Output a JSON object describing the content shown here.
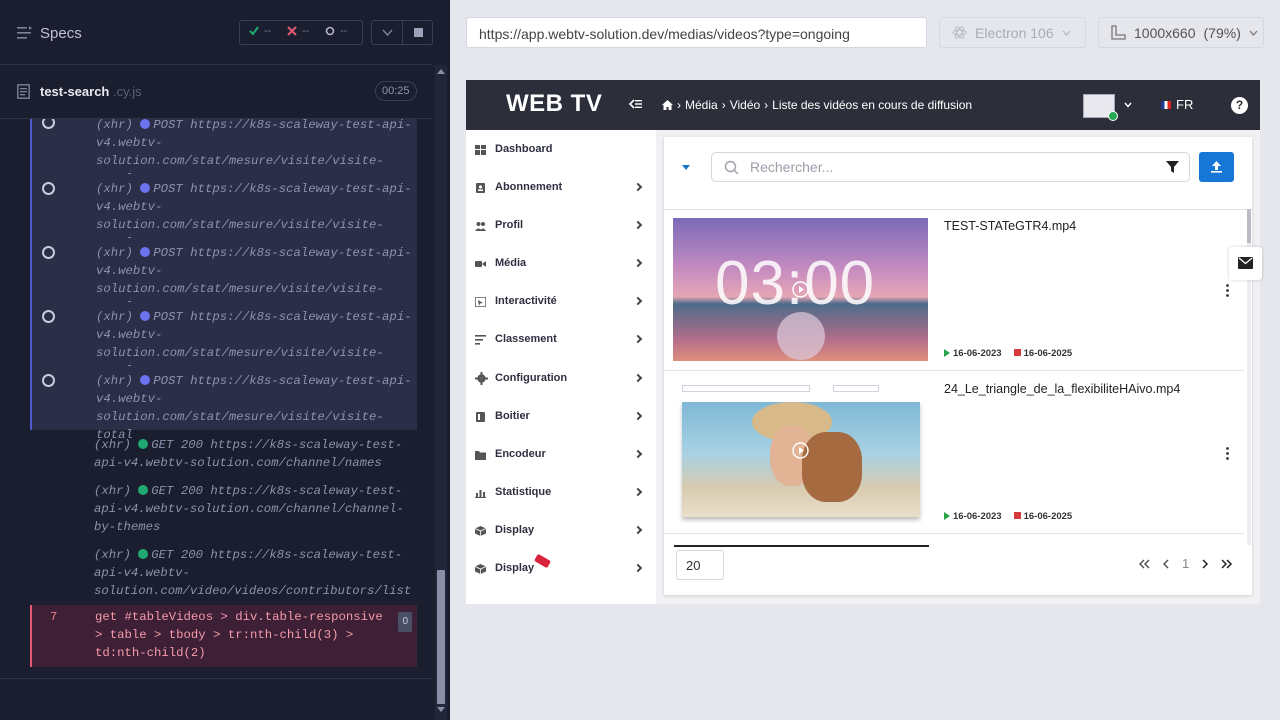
{
  "reporter": {
    "specs_label": "Specs",
    "stats": {
      "passed": "--",
      "failed": "--",
      "pending": "--"
    },
    "spec_name": "test-search",
    "spec_ext": ".cy.js",
    "duration": "00:25",
    "logs": [
      {
        "tag": "(xhr)",
        "method_url": "POST https://k8s-scaleway-test-api-v4.webtv-solution.com/stat/mesure/visite/visite-total",
        "status": "pending"
      },
      {
        "tag": "(xhr)",
        "method_url": "POST https://k8s-scaleway-test-api-v4.webtv-solution.com/stat/mesure/visite/visite-total",
        "status": "pending"
      },
      {
        "tag": "(xhr)",
        "method_url": "POST https://k8s-scaleway-test-api-v4.webtv-solution.com/stat/mesure/visite/visite-total",
        "status": "pending"
      },
      {
        "tag": "(xhr)",
        "method_url": "POST https://k8s-scaleway-test-api-v4.webtv-solution.com/stat/mesure/visite/visite-total",
        "status": "pending"
      },
      {
        "tag": "(xhr)",
        "method_url": "POST https://k8s-scaleway-test-api-v4.webtv-solution.com/stat/mesure/visite/visite-total",
        "status": "pending"
      },
      {
        "tag": "(xhr)",
        "method_url": "GET 200 https://k8s-scaleway-test-api-v4.webtv-solution.com/channel/names",
        "status": "ok"
      },
      {
        "tag": "(xhr)",
        "method_url": "GET 200 https://k8s-scaleway-test-api-v4.webtv-solution.com/channel/channel-by-themes",
        "status": "ok"
      },
      {
        "tag": "(xhr)",
        "method_url": "GET 200 https://k8s-scaleway-test-api-v4.webtv-solution.com/video/videos/contributors/list",
        "status": "ok"
      }
    ],
    "failed_cmd": {
      "number": "7",
      "text": "get  #tableVideos > div.table-responsive > table > tbody > tr:nth-child(3) > td:nth-child(2)",
      "badge": "0"
    }
  },
  "browser": {
    "url": "https://app.webtv-solution.dev/medias/videos?type=ongoing",
    "engine": "Electron 106",
    "viewport": "1000x660",
    "scale": "(79%)"
  },
  "app": {
    "logo": "WEB TV",
    "breadcrumb": [
      "Média",
      "Vidéo",
      "Liste des vidéos en cours de diffusion"
    ],
    "lang": "FR",
    "help": "?",
    "nav": [
      {
        "label": "Dashboard",
        "icon": "dashboard-icon",
        "chevron": false
      },
      {
        "label": "Abonnement",
        "icon": "subscription-icon",
        "chevron": true
      },
      {
        "label": "Profil",
        "icon": "users-icon",
        "chevron": true
      },
      {
        "label": "Média",
        "icon": "video-camera-icon",
        "chevron": true
      },
      {
        "label": "Interactivité",
        "icon": "interactivity-icon",
        "chevron": true
      },
      {
        "label": "Classement",
        "icon": "list-icon",
        "chevron": true
      },
      {
        "label": "Configuration",
        "icon": "gear-icon",
        "chevron": true
      },
      {
        "label": "Boitier",
        "icon": "box-icon",
        "chevron": true
      },
      {
        "label": "Encodeur",
        "icon": "folder-icon",
        "chevron": true
      },
      {
        "label": "Statistique",
        "icon": "chart-icon",
        "chevron": true
      },
      {
        "label": "Display",
        "icon": "cube-icon",
        "chevron": true
      },
      {
        "label": "Display",
        "icon": "cube-icon",
        "chevron": true
      }
    ],
    "search_placeholder": "Rechercher...",
    "videos": [
      {
        "title": "TEST-STATeGTR4.mp4",
        "thumb_text": "03:00",
        "start": "16-06-2023",
        "end": "16-06-2025"
      },
      {
        "title": "24_Le_triangle_de_la_flexibiliteHAivo.mp4",
        "thumb_text": "",
        "start": "16-06-2023",
        "end": "16-06-2025"
      }
    ],
    "page_size": "20",
    "current_page": "1",
    "colors": {
      "accent": "#1677d6",
      "dark_bar": "#2c2f3a",
      "start": "#2aa34a",
      "end": "#d63a3a"
    }
  }
}
